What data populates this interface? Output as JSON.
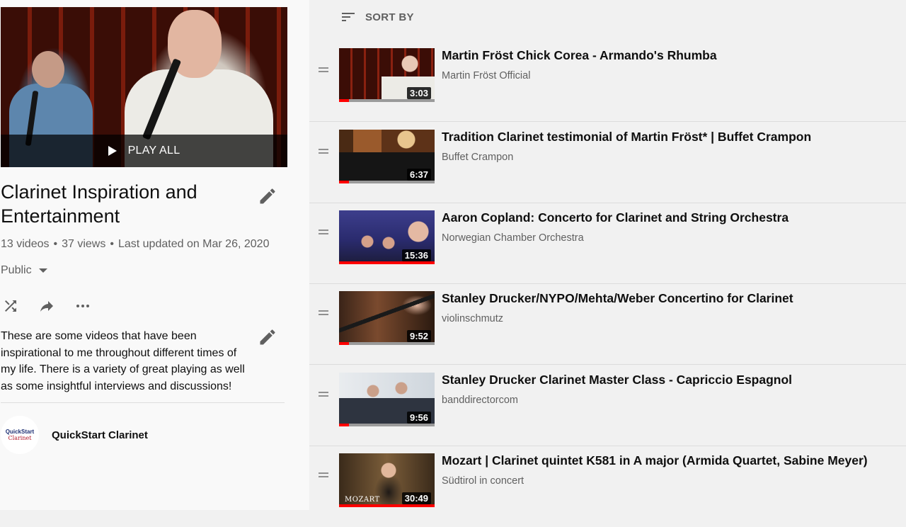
{
  "playlist": {
    "play_all_label": "PLAY ALL",
    "title": "Clarinet Inspiration and Entertainment",
    "video_count": "13 videos",
    "views": "37 views",
    "updated": "Last updated on Mar 26, 2020",
    "privacy": "Public",
    "description": "These are some videos that have been inspirational to me throughout different times of my life. There is a variety of great playing as well as some insightful interviews and discussions!",
    "owner": {
      "name": "QuickStart Clarinet",
      "avatar_line1": "QuickStart",
      "avatar_line2": "Clarinet"
    },
    "icons": [
      "play-icon",
      "edit-icon",
      "shuffle-icon",
      "share-icon",
      "more-icon"
    ]
  },
  "sort": {
    "label": "SORT BY",
    "icon": "sort-icon"
  },
  "videos": [
    {
      "title": "Martin Fröst Chick Corea - Armando's Rhumba",
      "channel": "Martin Fröst Official",
      "duration": "3:03",
      "progress": 0.1
    },
    {
      "title": "Tradition Clarinet testimonial of Martin Fröst* | Buffet Crampon",
      "channel": "Buffet Crampon",
      "duration": "6:37",
      "progress": 0.1
    },
    {
      "title": "Aaron Copland: Concerto for Clarinet and String Orchestra",
      "channel": "Norwegian Chamber Orchestra",
      "duration": "15:36",
      "progress": 1.0
    },
    {
      "title": "Stanley Drucker/NYPO/Mehta/Weber Concertino for Clarinet",
      "channel": "violinschmutz",
      "duration": "9:52",
      "progress": 0.1
    },
    {
      "title": "Stanley Drucker Clarinet Master Class - Capriccio Espagnol",
      "channel": "banddirectorcom",
      "duration": "9:56",
      "progress": 0.1
    },
    {
      "title": "Mozart | Clarinet quintet K581 in A major (Armida Quartet, Sabine Meyer)",
      "channel": "Südtirol in concert",
      "duration": "30:49",
      "progress": 1.0,
      "thumb_text": "MOZART"
    }
  ]
}
